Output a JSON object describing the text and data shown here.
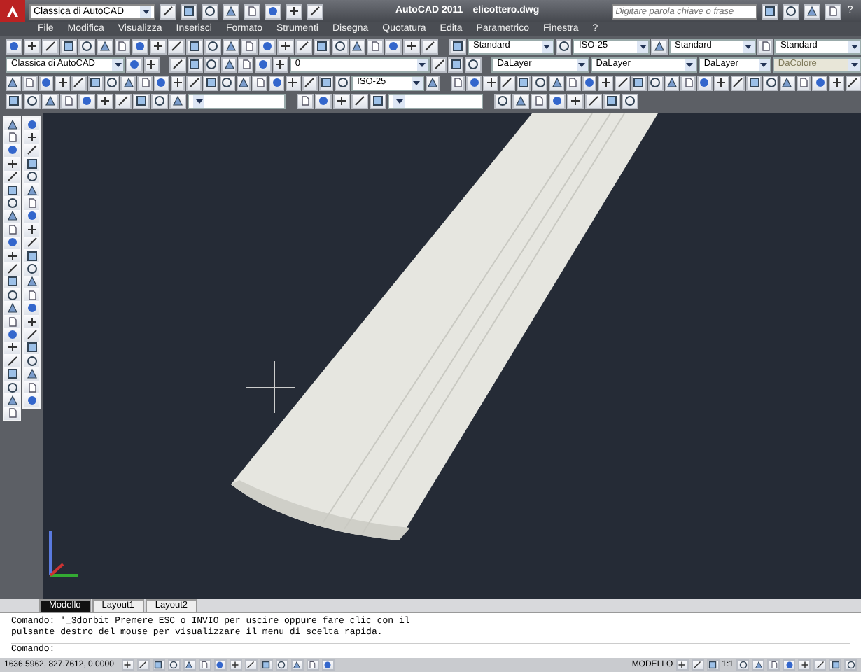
{
  "title_bar": {
    "workspace": "Classica di AutoCAD",
    "title": "AutoCAD 2011",
    "file_name": "elicottero.dwg",
    "search": {
      "placeholder": "Digitare parola chiave o frase"
    },
    "help": "?"
  },
  "menu": [
    "File",
    "Modifica",
    "Visualizza",
    "Inserisci",
    "Formato",
    "Strumenti",
    "Disegna",
    "Quotatura",
    "Edita",
    "Parametrico",
    "Finestra",
    "?"
  ],
  "toolbars": [
    {
      "dropdowns": [
        {
          "value": "Standard",
          "disabled": false
        },
        {
          "value": "ISO-25",
          "disabled": false
        },
        {
          "value": "Standard",
          "disabled": false
        },
        {
          "value": "Standard",
          "disabled": false
        }
      ]
    },
    {
      "dropdowns": [
        {
          "value": "Classica di AutoCAD",
          "disabled": false
        },
        {
          "value": "0",
          "disabled": false
        },
        {
          "value": "DaLayer",
          "disabled": false
        },
        {
          "value": "DaLayer",
          "disabled": false
        },
        {
          "value": "DaLayer",
          "disabled": false
        },
        {
          "value": "DaColore",
          "disabled": true
        }
      ]
    },
    {
      "dropdowns": [
        {
          "value": "ISO-25",
          "disabled": false
        }
      ]
    }
  ],
  "layout_tabs": [
    {
      "label": "Modello",
      "selected": true
    },
    {
      "label": "Layout1",
      "selected": false
    },
    {
      "label": "Layout2",
      "selected": false
    }
  ],
  "command_history": [
    "Comando: '_3dorbit Premere ESC o INVIO per uscire oppure fare clic con il",
    "pulsante destro del mouse per visualizzare il menu di scelta rapida."
  ],
  "command_prompt": "Comando:",
  "status_bar": {
    "coordinates": "1636.5962, 827.7612, 0.0000",
    "space": "MODELLO",
    "scale": "1:1"
  }
}
